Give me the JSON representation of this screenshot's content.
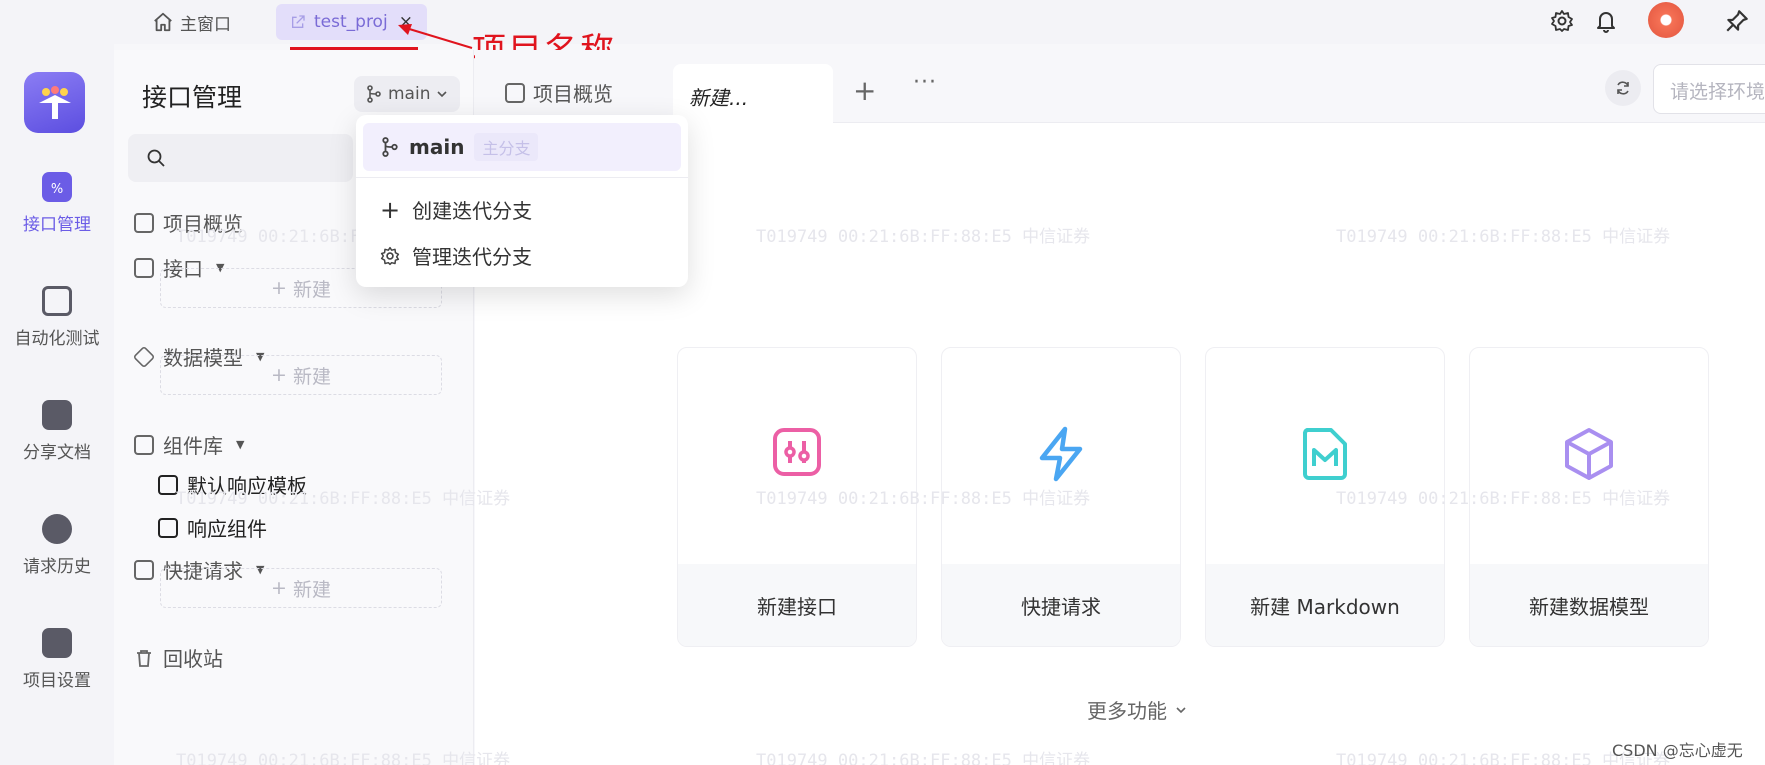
{
  "topbar": {
    "home_tab": "主窗口",
    "project_tab": "test_proj",
    "close_glyph": "×",
    "annotation": "项目名称"
  },
  "rail": {
    "items": [
      {
        "label": "接口管理",
        "icon": "api-icon",
        "active": true
      },
      {
        "label": "自动化测试",
        "icon": "automation-icon"
      },
      {
        "label": "分享文档",
        "icon": "share-doc-icon"
      },
      {
        "label": "请求历史",
        "icon": "history-icon"
      },
      {
        "label": "项目设置",
        "icon": "project-settings-icon"
      }
    ]
  },
  "sidebar": {
    "title": "接口管理",
    "branch": "main",
    "tree": {
      "overview": "项目概览",
      "api": "接口",
      "models": "数据模型",
      "components": "组件库",
      "default_response": "默认响应模板",
      "response_component": "响应组件",
      "quick_request": "快捷请求",
      "recycle": "回收站",
      "new_label": "新建",
      "plus": "+"
    }
  },
  "dropdown": {
    "main_branch": "main",
    "main_tag": "主分支",
    "create": "创建迭代分支",
    "manage": "管理迭代分支",
    "plus": "+"
  },
  "main": {
    "tab_overview": "项目概览",
    "tab_new": "新建...",
    "tab_add": "+",
    "tab_more": "···",
    "env_placeholder": "请选择环境",
    "cards": [
      {
        "label": "新建接口",
        "icon": "api-icon",
        "color": "#ec5fa5"
      },
      {
        "label": "快捷请求",
        "icon": "lightning-icon",
        "color": "#4aa6f2"
      },
      {
        "label": "新建 Markdown",
        "icon": "markdown-icon",
        "color": "#3fcfcf"
      },
      {
        "label": "新建数据模型",
        "icon": "cube-icon",
        "color": "#a98ff0"
      }
    ],
    "more": "更多功能"
  },
  "watermark": "T019749  00:21:6B:FF:88:E5  中信证券",
  "credit": "CSDN @忘心虚无",
  "colors": {
    "accent": "#6b5ce6",
    "annotation": "#e0141e"
  }
}
